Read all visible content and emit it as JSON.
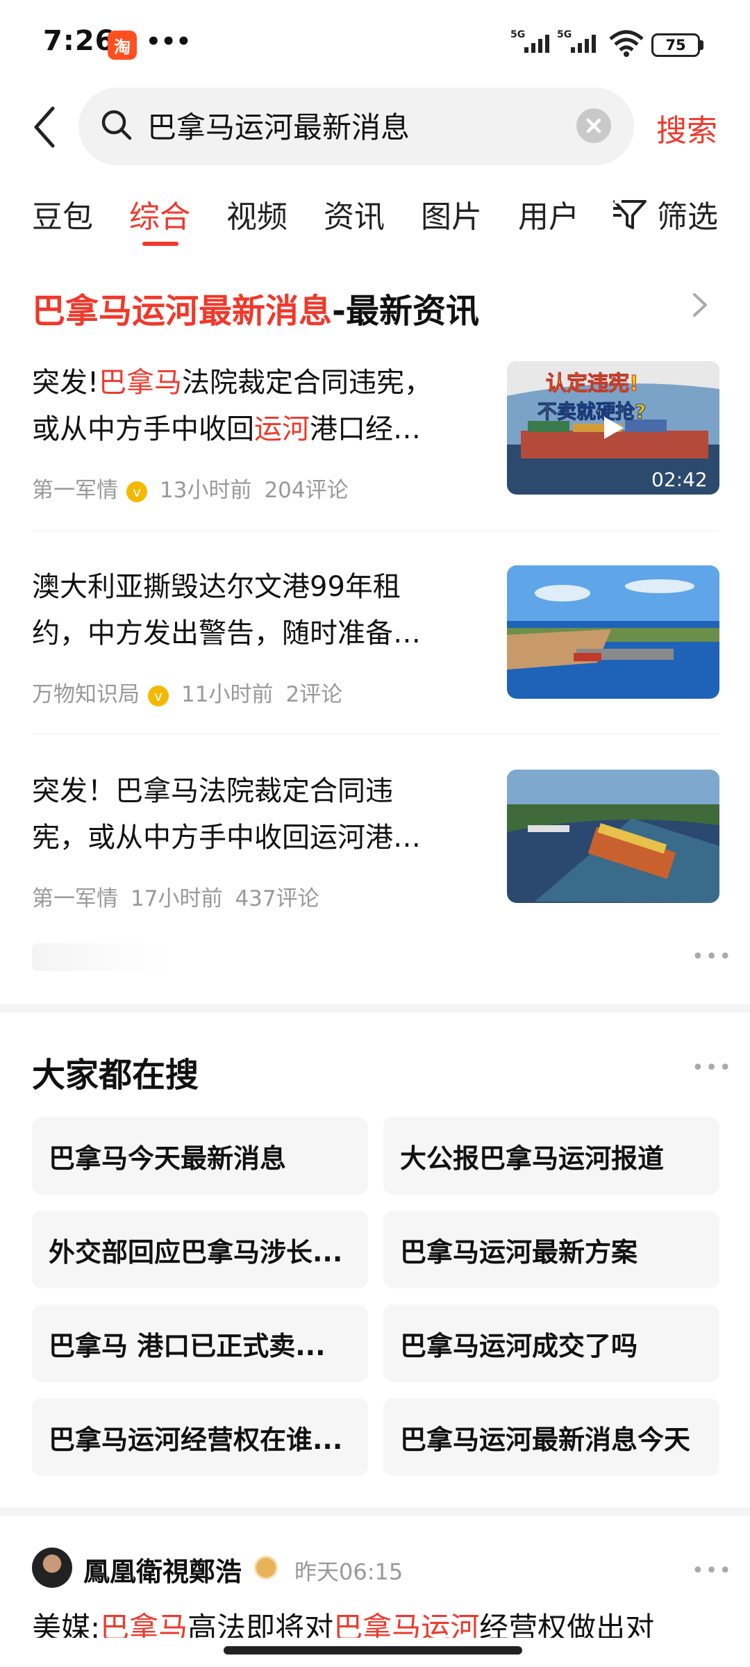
{
  "status_bar": {
    "time": "7:26",
    "app_icon": "淘",
    "more": "•••",
    "signal1": "5G",
    "signal2": "5G",
    "battery": "75"
  },
  "search": {
    "query": "巴拿马运河最新消息",
    "button": "搜索"
  },
  "tabs": [
    "豆包",
    "综合",
    "视频",
    "资讯",
    "图片",
    "用户",
    "筛选"
  ],
  "active_tab": "综合",
  "news": {
    "title_highlight": "巴拿马运河最新消息",
    "title_rest": "-最新资讯",
    "items": [
      {
        "line1_pre": "突发!",
        "line1_hl": "巴拿马",
        "line1_post": "法院裁定合同违宪，",
        "line2_pre": "或从中方手中收回",
        "line2_hl": "运河",
        "line2_post": "港口经…",
        "source": "第一军情",
        "time": "13小时前",
        "comments": "204评论",
        "thumb_caption_1": "认定违宪!",
        "thumb_caption_2": "不卖就硬抢?",
        "duration": "02:42"
      },
      {
        "line1": "澳大利亚撕毁达尔文港99年租",
        "line2": "约，中方发出警告，随时准备…",
        "source": "万物知识局",
        "time": "11小时前",
        "comments": "2评论"
      },
      {
        "line1": "突发！巴拿马法院裁定合同违",
        "line2": "宪，或从中方手中收回运河港…",
        "source": "第一军情",
        "time": "17小时前",
        "comments": "437评论"
      }
    ]
  },
  "hot_searches": {
    "title": "大家都在搜",
    "items": [
      "巴拿马今天最新消息",
      "大公报巴拿马运河报道",
      "外交部回应巴拿马涉长...",
      "巴拿马运河最新方案",
      "巴拿马 港口已正式卖...",
      "巴拿马运河成交了吗",
      "巴拿马运河经营权在谁...",
      "巴拿马运河最新消息今天"
    ]
  },
  "post": {
    "author": "鳳凰衛視鄭浩",
    "time": "昨天06:15",
    "text_1": "美媒:",
    "text_hl_1": "巴拿马",
    "text_2": "高法即将对",
    "text_hl_2": "巴拿马运河",
    "text_3": "经营权做出对"
  },
  "colors": {
    "accent": "#f0382b",
    "muted": "#999999",
    "chip_bg": "#f6f6f6"
  },
  "icons": [
    "back-icon",
    "search-icon",
    "clear-icon",
    "filter-icon",
    "chevron-right-icon",
    "verified-icon",
    "play-icon",
    "more-icon"
  ]
}
